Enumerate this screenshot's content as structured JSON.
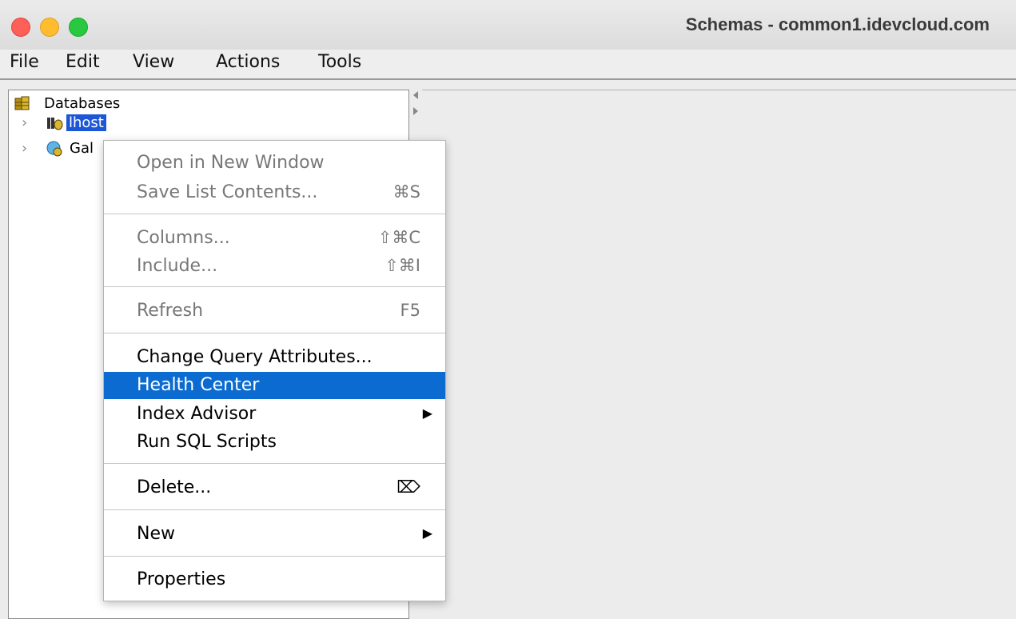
{
  "window": {
    "title": "Schemas - common1.idevcloud.com"
  },
  "menubar": {
    "file": "File",
    "edit": "Edit",
    "view": "View",
    "actions": "Actions",
    "tools": "Tools"
  },
  "tree": {
    "root": "Databases",
    "items": [
      {
        "label": "lhost",
        "selected": true
      },
      {
        "label": "Galaxy",
        "visible_text": "Gal"
      }
    ]
  },
  "context_menu": {
    "open_new_window": "Open in New Window",
    "save_list": "Save List Contents...",
    "save_list_shortcut": "⌘S",
    "columns": "Columns...",
    "columns_shortcut": "⇧⌘C",
    "include": "Include...",
    "include_shortcut": "⇧⌘I",
    "refresh": "Refresh",
    "refresh_shortcut": "F5",
    "change_query": "Change Query Attributes...",
    "health_center": "Health Center",
    "index_advisor": "Index Advisor",
    "run_sql": "Run SQL Scripts",
    "delete": "Delete...",
    "delete_shortcut": "⌦",
    "new": "New",
    "properties": "Properties"
  },
  "colors": {
    "selection": "#1d57d8",
    "menu_highlight": "#0b6bd0"
  }
}
